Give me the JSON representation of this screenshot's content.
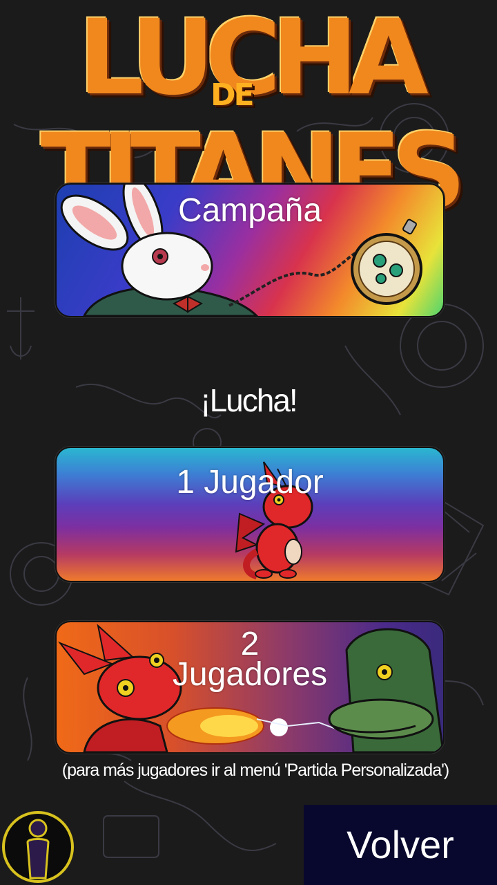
{
  "title": {
    "main": "LUCHA TITANES",
    "small": "DE"
  },
  "menu": {
    "campaign_label": "Campaña",
    "fight_heading": "¡Lucha!",
    "one_player_label": "1 Jugador",
    "two_player_line1": "2",
    "two_player_line2": "Jugadores",
    "footnote": "(para más jugadores ir al menú 'Partida Personalizada')",
    "back_label": "Volver"
  },
  "colors": {
    "background": "#1b1b1b",
    "title_orange": "#f0881e",
    "back_button": "#08082e",
    "logo_yellow": "#d8c21e"
  },
  "icons": {
    "corner": "player-silhouette-icon",
    "campaign_art": "white-rabbit-pocket-watch",
    "one_player_art": "red-dragon",
    "two_player_art": "dragon-vs-lizard"
  }
}
